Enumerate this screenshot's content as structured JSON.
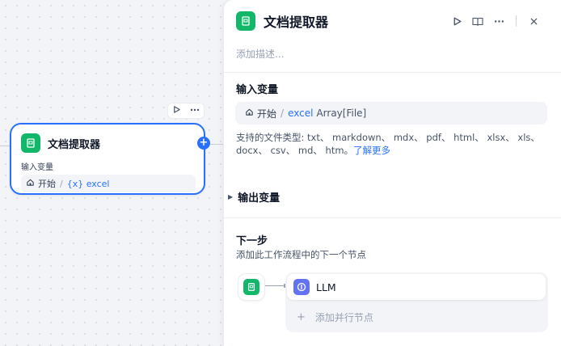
{
  "node": {
    "title": "文档提取器",
    "input_label": "输入变量",
    "start_label": "开始",
    "separator": "/",
    "var_label": "{x} excel"
  },
  "panel": {
    "title": "文档提取器",
    "description_placeholder": "添加描述...",
    "input_section": {
      "title": "输入变量",
      "start_label": "开始",
      "separator": "/",
      "var_name": "excel",
      "var_type": "Array[File]"
    },
    "supported_types_text": "支持的文件类型: txt、 markdown、 mdx、 pdf、 html、 xlsx、 xls、 docx、 csv、 md、 htm。",
    "learn_more": "了解更多",
    "output_section": {
      "title": "输出变量"
    },
    "next_step": {
      "title": "下一步",
      "description": "添加此工作流程中的下一个节点",
      "target_label": "LLM",
      "add_parallel": "添加并行节点"
    }
  },
  "colors": {
    "accent": "#2970ff",
    "extractor_icon": "#12b76a",
    "llm_icon": "#6172f3"
  },
  "icons": [
    "document-icon",
    "home-icon",
    "play-icon",
    "more-icon",
    "book-icon",
    "close-icon",
    "plus-icon",
    "llm-icon",
    "chevron-right-icon"
  ]
}
